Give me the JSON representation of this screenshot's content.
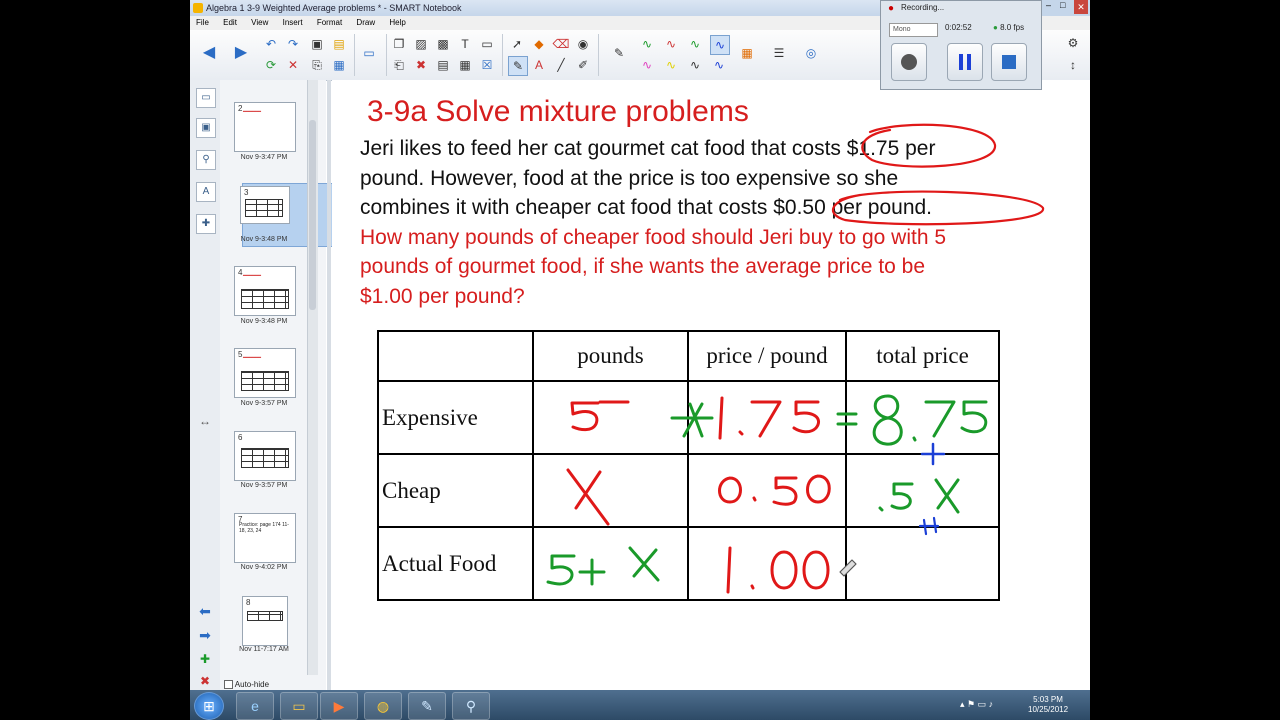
{
  "window": {
    "title": "Algebra 1 3-9 Weighted Average problems * - SMART Notebook"
  },
  "menu": [
    "File",
    "Edit",
    "View",
    "Insert",
    "Format",
    "Draw",
    "Help"
  ],
  "recorder": {
    "title": "Recording...",
    "mode": "Mono",
    "time": "0:02:52",
    "fps": "8.0 fps"
  },
  "sorter": {
    "slides": [
      {
        "num": "2",
        "label": "Nov 9-3:47 PM"
      },
      {
        "num": "3",
        "label": "Nov 9-3:48 PM"
      },
      {
        "num": "4",
        "label": "Nov 9-3:48 PM"
      },
      {
        "num": "5",
        "label": "Nov 9-3:57 PM"
      },
      {
        "num": "6",
        "label": "Nov 9-3:57 PM"
      },
      {
        "num": "7",
        "label": "Nov 9-4:02 PM",
        "text": "Practice: page 174 11-18, 23, 24"
      },
      {
        "num": "8",
        "label": "Nov 11-7:17 AM"
      }
    ],
    "autohide": "Auto-hide"
  },
  "page": {
    "heading": "3-9a Solve mixture problems",
    "para1": [
      "Jeri likes to feed her cat gourmet cat food that costs $1.75 per",
      "pound.  However, food at the price is too expensive so she",
      "combines it with cheaper cat food that costs $0.50 per pound."
    ],
    "question": [
      "How many pounds of cheaper food should Jeri buy to go with 5",
      "pounds of gourmet food, if she wants the average price to be",
      "$1.00 per pound?"
    ],
    "table": {
      "headers": [
        "",
        "pounds",
        "price / pound",
        "total price"
      ],
      "rows": [
        "Expensive",
        "Cheap",
        "Actual Food"
      ]
    },
    "handwritten": {
      "expensive": {
        "pounds": "5",
        "price": "1.75",
        "total": "8.75"
      },
      "cheap": {
        "pounds": "X",
        "price": "0.50",
        "total": ".5X"
      },
      "actual": {
        "pounds": "5+X",
        "price": "1.00"
      }
    },
    "ink_colors": {
      "red": "#e01818",
      "green": "#1a9a2a",
      "blue": "#1b3fd6"
    }
  },
  "taskbar": {
    "time": "5:03 PM",
    "date": "10/25/2012"
  }
}
